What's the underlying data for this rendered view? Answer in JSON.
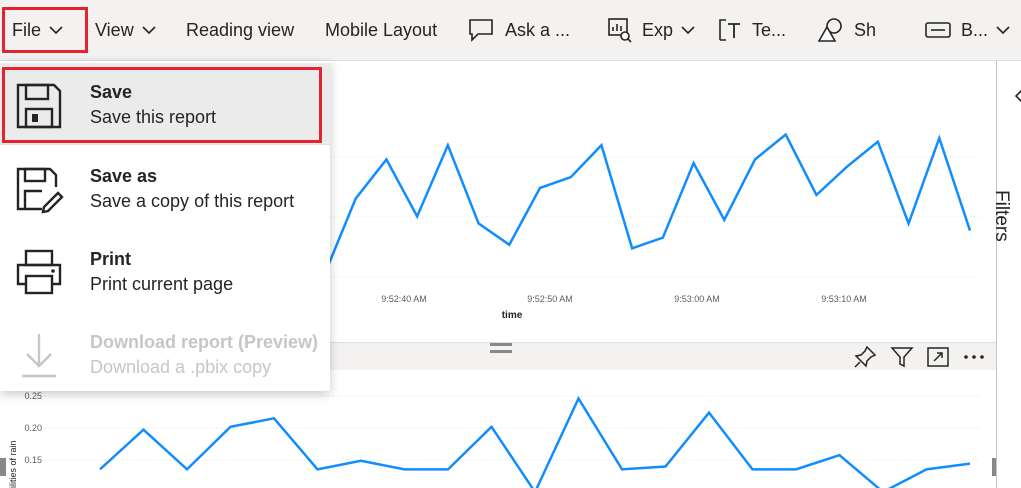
{
  "toolbar": {
    "file": "File",
    "view": "View",
    "reading_view": "Reading view",
    "mobile_layout": "Mobile Layout",
    "ask": "Ask a ...",
    "export": "Exp",
    "text": "Te...",
    "shapes": "Sh",
    "buttons": "B..."
  },
  "file_menu": {
    "items": [
      {
        "title": "Save",
        "desc": "Save this report",
        "icon": "save-icon",
        "enabled": true
      },
      {
        "title": "Save as",
        "desc": "Save a copy of this report",
        "icon": "save-as-icon",
        "enabled": true
      },
      {
        "title": "Print",
        "desc": "Print current page",
        "icon": "print-icon",
        "enabled": true
      },
      {
        "title": "Download report (Preview)",
        "desc": "Download a .pbix copy",
        "icon": "download-icon",
        "enabled": false
      }
    ]
  },
  "filters_pane": {
    "label": "Filters"
  },
  "chart_data": [
    {
      "type": "line",
      "xlabel": "time",
      "x_ticks": [
        "9:52:40 AM",
        "9:52:50 AM",
        "9:53:00 AM",
        "9:53:10 AM"
      ],
      "values": [
        0.5,
        2.6,
        3.7,
        2.1,
        4.1,
        1.9,
        1.3,
        2.9,
        3.2,
        4.1,
        1.2,
        1.5,
        3.6,
        2.0,
        3.7,
        4.4,
        2.7,
        3.5,
        4.2,
        1.9,
        4.3,
        1.7
      ],
      "color": "#118dff"
    },
    {
      "type": "line",
      "ylabel": "ilities of rain",
      "y_ticks": [
        "0.25",
        "0.20",
        "0.15"
      ],
      "values": [
        0.11,
        0.18,
        0.11,
        0.185,
        0.2,
        0.11,
        0.125,
        0.11,
        0.11,
        0.185,
        0.07,
        0.235,
        0.11,
        0.115,
        0.21,
        0.11,
        0.11,
        0.135,
        0.07,
        0.11,
        0.12
      ],
      "color": "#118dff"
    }
  ],
  "colors": {
    "accent": "#118dff",
    "highlight": "#e3232d"
  }
}
